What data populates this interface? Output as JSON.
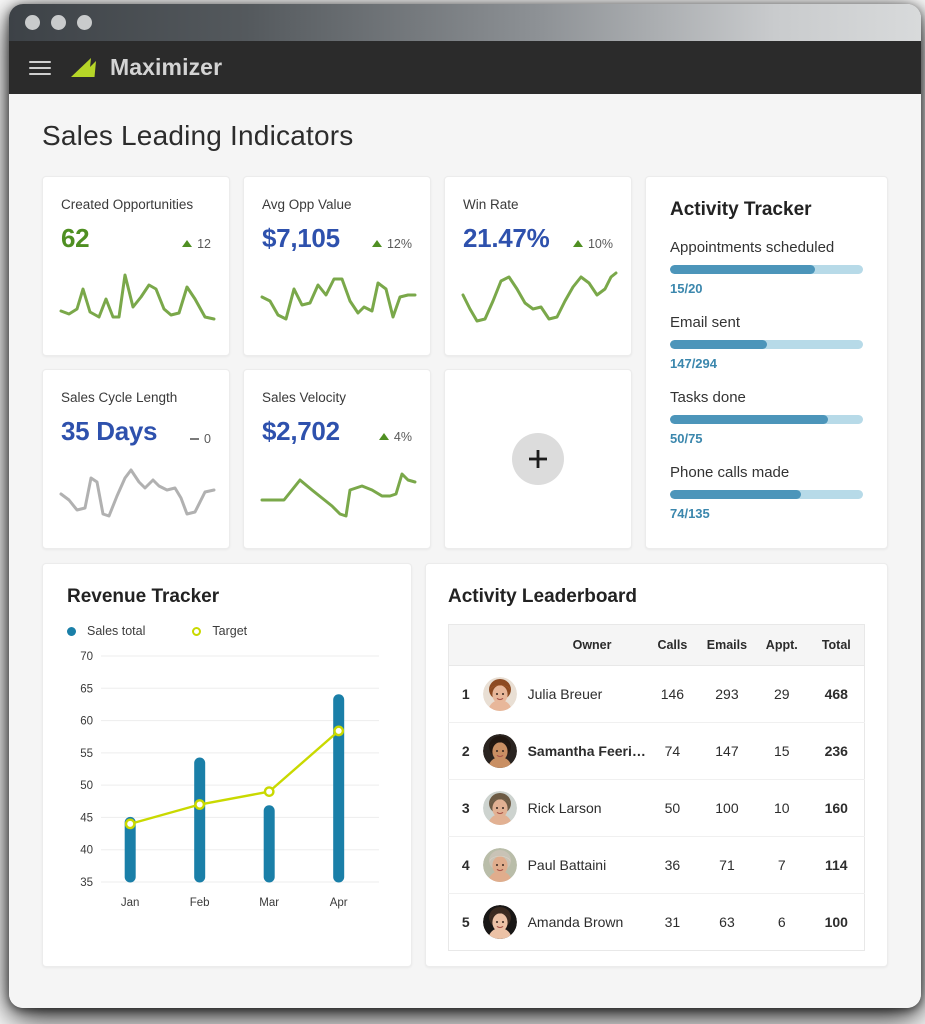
{
  "window": {
    "traffic_lights": [
      "close",
      "minimize",
      "maximize"
    ],
    "brand": "Maximizer",
    "menu_icon": "hamburger-icon"
  },
  "page": {
    "title": "Sales Leading Indicators"
  },
  "kpis": [
    {
      "label": "Created Opportunities",
      "value": "62",
      "value_color": "green",
      "delta": "12",
      "delta_dir": "up",
      "spark_color": "#7aa84a"
    },
    {
      "label": "Avg Opp Value",
      "value": "$7,105",
      "value_color": "blue",
      "delta": "12%",
      "delta_dir": "up",
      "spark_color": "#7aa84a"
    },
    {
      "label": "Win Rate",
      "value": "21.47%",
      "value_color": "blue",
      "delta": "10%",
      "delta_dir": "up",
      "spark_color": "#7aa84a"
    },
    {
      "label": "Sales Cycle Length",
      "value": "35 Days",
      "value_color": "blue",
      "delta": "0",
      "delta_dir": "flat",
      "spark_color": "#b1b1b1"
    },
    {
      "label": "Sales Velocity",
      "value": "$2,702",
      "value_color": "blue",
      "delta": "4%",
      "delta_dir": "up",
      "spark_color": "#7aa84a"
    }
  ],
  "add_card": {
    "icon": "plus-icon",
    "label": "+"
  },
  "activity_tracker": {
    "title": "Activity Tracker",
    "fill_color": "#4c95ba",
    "track_color": "#b7dae8",
    "items": [
      {
        "name": "Appointments scheduled",
        "count": "15/20",
        "value": 15,
        "max": 20,
        "percent": 75
      },
      {
        "name": "Email sent",
        "count": "147/294",
        "value": 147,
        "max": 294,
        "percent": 50
      },
      {
        "name": "Tasks done",
        "count": "50/75",
        "value": 50,
        "max": 75,
        "percent": 82
      },
      {
        "name": "Phone calls made",
        "count": "74/135",
        "value": 74,
        "max": 135,
        "percent": 68
      }
    ]
  },
  "revenue_tracker": {
    "title": "Revenue Tracker"
  },
  "chart_data": {
    "type": "bar",
    "title": "Revenue Tracker",
    "xlabel": "",
    "ylabel": "",
    "categories": [
      "Jan",
      "Feb",
      "Mar",
      "Apr"
    ],
    "ylim": [
      35,
      70
    ],
    "yticks": [
      70,
      65,
      60,
      55,
      50,
      45,
      40,
      35
    ],
    "grid": true,
    "legend_position": "top-left",
    "series": [
      {
        "name": "Sales total",
        "type": "bar",
        "color": "#1a7fa8",
        "values": [
          45.0,
          54.2,
          46.8,
          64.0
        ],
        "baseline": 35
      },
      {
        "name": "Target",
        "type": "line",
        "color": "#c9d900",
        "values": [
          44.0,
          47.0,
          49.0,
          58.4
        ],
        "marker": "open-circle"
      }
    ]
  },
  "leaderboard": {
    "title": "Activity Leaderboard",
    "columns": [
      "",
      "Owner",
      "Calls",
      "Emails",
      "Appt.",
      "Total"
    ],
    "rows": [
      {
        "rank": "1",
        "name": "Julia Breuer",
        "bold": false,
        "calls": "146",
        "emails": "293",
        "appt": "29",
        "total": "468",
        "avatar": "avatar-julia"
      },
      {
        "rank": "2",
        "name": "Samantha Feeri…",
        "bold": true,
        "calls": "74",
        "emails": "147",
        "appt": "15",
        "total": "236",
        "avatar": "avatar-samantha"
      },
      {
        "rank": "3",
        "name": "Rick Larson",
        "bold": false,
        "calls": "50",
        "emails": "100",
        "appt": "10",
        "total": "160",
        "avatar": "avatar-rick"
      },
      {
        "rank": "4",
        "name": "Paul Battaini",
        "bold": false,
        "calls": "36",
        "emails": "71",
        "appt": "7",
        "total": "114",
        "avatar": "avatar-paul"
      },
      {
        "rank": "5",
        "name": "Amanda Brown",
        "bold": false,
        "calls": "31",
        "emails": "63",
        "appt": "6",
        "total": "100",
        "avatar": "avatar-amanda"
      }
    ]
  },
  "colors": {
    "brand_green": "#b6d628",
    "accent_blue": "#2e51ad",
    "kpi_green": "#4f8f22",
    "chart_blue": "#1a7fa8",
    "chart_yellow": "#c9d900",
    "tracker_blue": "#4c95ba",
    "appbar": "#2b2b2b",
    "page_bg": "#f5f5f5"
  }
}
